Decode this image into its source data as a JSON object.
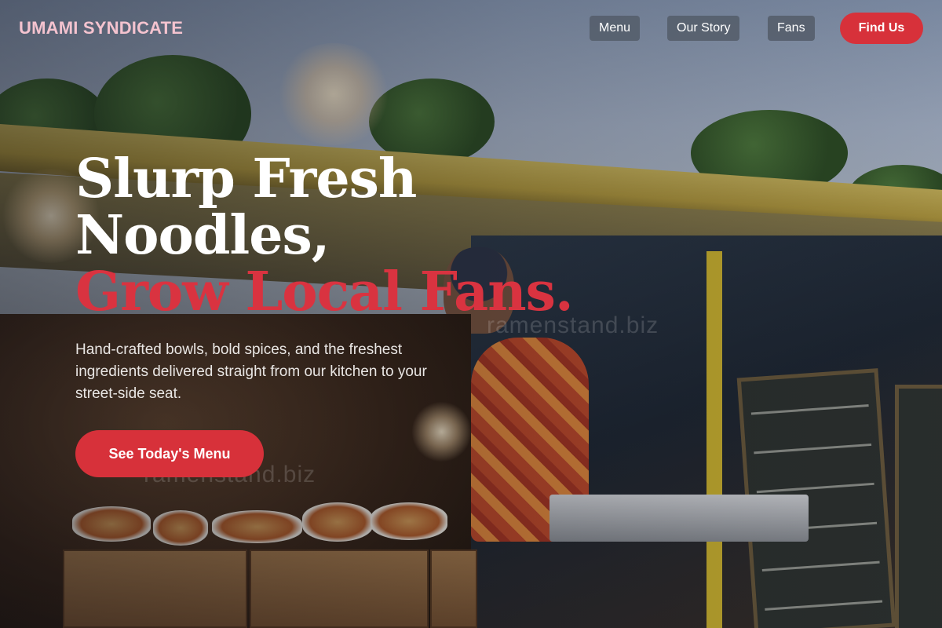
{
  "header": {
    "brand": "UMAMI SYNDICATE",
    "nav": [
      {
        "label": "Menu"
      },
      {
        "label": "Our Story"
      },
      {
        "label": "Fans"
      }
    ],
    "cta_label": "Find Us"
  },
  "hero": {
    "title_line1": "Slurp Fresh",
    "title_line2": "Noodles,",
    "title_accent": "Grow Local Fans.",
    "subtitle": "Hand-crafted bowls, bold spices, and the freshest ingredients delivered straight from our kitchen to your street-side seat.",
    "cta_label": "See Today's Menu"
  },
  "watermarks": [
    "ramenstand.biz",
    "ramenstand.biz"
  ],
  "colors": {
    "brand_pink": "#f4c3cf",
    "accent_red": "#d7313a",
    "nav_bg": "#555e6c"
  }
}
